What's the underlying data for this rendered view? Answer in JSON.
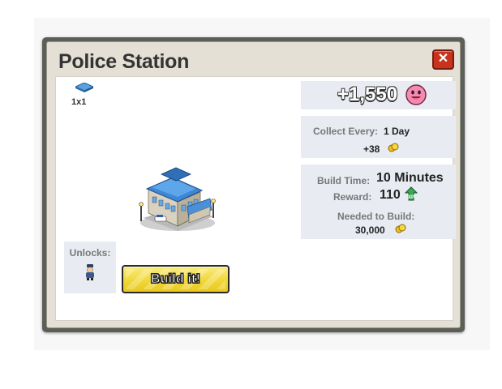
{
  "dialog": {
    "title": "Police Station",
    "close_label": "✕",
    "footprint": "1x1",
    "building_icon": "police-station-building-icon",
    "unlocks_label": "Unlocks:",
    "unlocks_icon": "police-officer-icon",
    "build_button_label": "Build it!"
  },
  "reward_panel": {
    "amount": "+1,550",
    "icon": "pink-happy-face-icon"
  },
  "collect_panel": {
    "label": "Collect Every:",
    "value": "1 Day",
    "coins": "+38",
    "coin_icon": "coin-icon"
  },
  "build_panel": {
    "time_label": "Build Time:",
    "time_value": "10 Minutes",
    "reward_label": "Reward:",
    "reward_value": "110",
    "xp_icon": "xp-badge-icon",
    "needed_label": "Needed to Build:",
    "needed_value": "30,000",
    "coin_icon": "coin-icon"
  },
  "colors": {
    "frame": "#5c5f58",
    "title_bar": "#e5e0d5",
    "panel_bg": "#e8ecf2",
    "close_button": "#c8331d",
    "build_button": "#f2d93d",
    "coin": "#f0c020",
    "happy_face": "#f28bb2"
  }
}
